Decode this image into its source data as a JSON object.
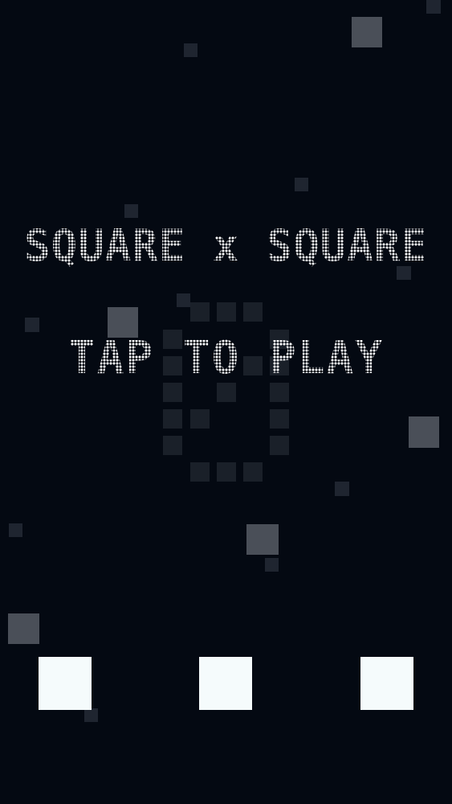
{
  "game": {
    "title": "SQUARE x SQUARE",
    "prompt": "TAP TO PLAY",
    "score": 0
  },
  "colors": {
    "background": "#040912",
    "text": "#ffffff",
    "player_square": "#f5fbfc",
    "falling_square_light": "#4a4f58",
    "falling_square_dark": "#1f2530"
  }
}
